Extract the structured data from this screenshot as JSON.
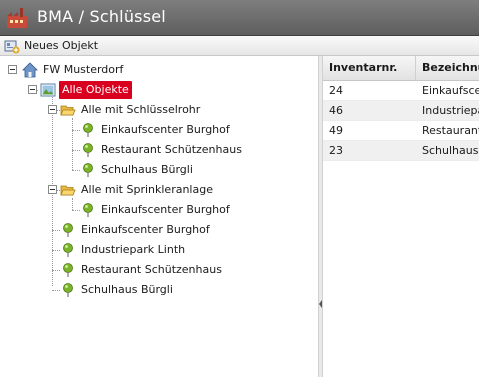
{
  "app": {
    "title": "BMA / Schlüssel"
  },
  "toolbar": {
    "new_object_label": "Neues Objekt"
  },
  "tree": {
    "root": "FW Musterdorf",
    "all_objects": "Alle Objekte",
    "group_keytube": {
      "label": "Alle mit Schlüsselrohr",
      "items": [
        "Einkaufscenter Burghof",
        "Restaurant Schützenhaus",
        "Schulhaus Bürgli"
      ]
    },
    "group_sprinkler": {
      "label": "Alle mit Sprinkleranlage",
      "items": [
        "Einkaufscenter Burghof"
      ]
    },
    "objects": [
      "Einkaufscenter Burghof",
      "Industriepark Linth",
      "Restaurant Schützenhaus",
      "Schulhaus Bürgli"
    ]
  },
  "grid": {
    "columns": [
      "Inventarnr.",
      "Bezeichnung"
    ],
    "rows": [
      {
        "inventory": "24",
        "name": "Einkaufscenter Burghof"
      },
      {
        "inventory": "46",
        "name": "Industriepark Linth"
      },
      {
        "inventory": "49",
        "name": "Restaurant Schützenhaus"
      },
      {
        "inventory": "23",
        "name": "Schulhaus Bürgli"
      }
    ]
  },
  "colors": {
    "titlebar": "#6a6a6a",
    "selection": "#d8001e",
    "pin": "#7cb32a"
  }
}
